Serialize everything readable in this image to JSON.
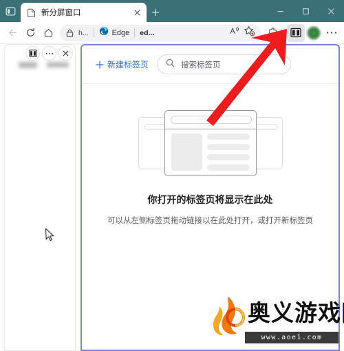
{
  "window": {
    "titlebar": {
      "tab_actions_icon": "tab-actions-sidebar-icon",
      "minimize_label": "—",
      "maximize_label": "□",
      "close_label": "×",
      "bg_color": "#3a7076"
    },
    "tab": {
      "favicon": "page-icon",
      "title": "新分屏窗口",
      "close_label": "×"
    },
    "new_tab_button_label": "+"
  },
  "toolbar": {
    "back_icon": "back-arrow-icon",
    "refresh_icon": "refresh-icon",
    "home_icon": "home-icon",
    "omnibox": {
      "lock_icon": "lock-icon",
      "url_text": "h...",
      "edge_chip_label": "Edge",
      "edge_chip_icon": "edge-logo-icon",
      "trailing_text": "ed...",
      "read_aloud_icon": "read-aloud-icon",
      "favorite_icon": "add-favorite-star-icon"
    },
    "extensions_icon": "extensions-puzzle-icon",
    "split_screen_icon": "split-screen-icon",
    "profile_icon": "profile-avatar",
    "settings_icon": "more-settings-ellipsis-icon"
  },
  "left_pane": {
    "split_icon": "split-screen-icon",
    "more_label": "⋯",
    "close_label": "×"
  },
  "right_pane": {
    "new_tab_label": "新建标签页",
    "new_tab_plus": "+",
    "search_icon": "search-icon",
    "search_placeholder": "搜索标签页",
    "empty_title": "你打开的标签页将显示在此处",
    "empty_subtitle": "可以从左侧标签页拖动链接以在此处打开，或打开新标签页",
    "border_color": "#7b7fe0",
    "link_color": "#2b6fd4"
  },
  "annotation": {
    "arrow_color": "#ee1c1c",
    "arrow_name": "red-pointer-arrow"
  },
  "watermark": {
    "brand": "奥义游戏网",
    "url": "www.aoe1.com",
    "logo": "flame-logo-icon"
  }
}
